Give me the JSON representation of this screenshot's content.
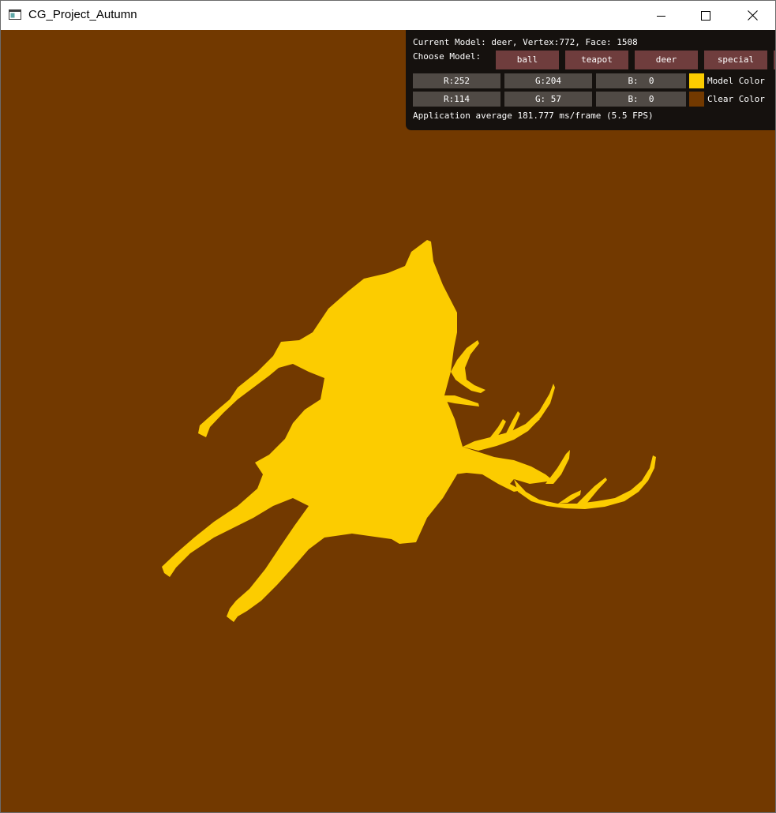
{
  "window": {
    "title": "CG_Project_Autumn",
    "controls": {
      "minimize": "minimize-icon",
      "maximize": "maximize-icon",
      "close": "close-icon"
    }
  },
  "scene": {
    "clear_color_hex": "#723900",
    "model_color_hex": "#fccc00",
    "model": "deer"
  },
  "panel": {
    "current_model_line": "Current Model: deer, Vertex:772, Face: 1508",
    "choose_model_label": "Choose Model:",
    "model_buttons": [
      "ball",
      "teapot",
      "deer",
      "special"
    ],
    "model_color": {
      "r": "R:252",
      "g": "G:204",
      "b": "B:  0",
      "label": "Model Color",
      "hex": "#fccc00"
    },
    "clear_color": {
      "r": "R:114",
      "g": "G: 57",
      "b": "B:  0",
      "label": "Clear Color",
      "hex": "#723900"
    },
    "fps_line": "Application average 181.777 ms/frame (5.5 FPS)"
  }
}
